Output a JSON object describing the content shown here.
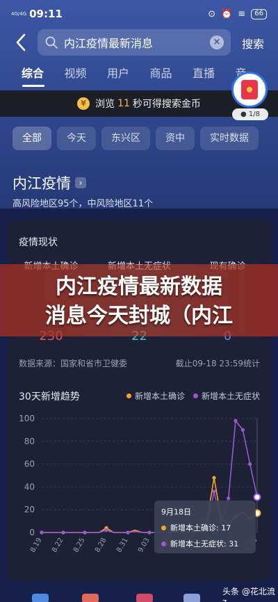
{
  "status": {
    "network": "4G/4G",
    "time": "09:11",
    "battery": "66"
  },
  "search": {
    "query": "内江疫情最新消息",
    "button": "搜索"
  },
  "tabs": [
    "综合",
    "视频",
    "用户",
    "商品",
    "直播",
    "音"
  ],
  "coin_bar": {
    "prefix": "浏览",
    "seconds": "11",
    "suffix": "秒可得搜索金币"
  },
  "reward": {
    "progress": "1/8"
  },
  "chips": [
    "全部",
    "今天",
    "东兴区",
    "资中",
    "实时数据"
  ],
  "section": {
    "title": "内江疫情",
    "summary": "高风险地区95个，中风险地区11个"
  },
  "card": {
    "title": "疫情现状",
    "stats": [
      {
        "label": "新增本土确诊",
        "value": "230",
        "color": "#e5535d"
      },
      {
        "label": "新增本土无症状",
        "value": "22",
        "color": "#3ac6cf"
      },
      {
        "label": "现有确诊",
        "value": "0",
        "color": "#5f84d6"
      }
    ],
    "source": "数据来源：国家和省市卫健委",
    "updated": "截止09-18 23:59统计",
    "trend_title": "30天新增趋势"
  },
  "tooltip": {
    "date": "9月18日",
    "row1": "新增本土确诊: 17",
    "row2": "新增本土无症状: 31"
  },
  "banner": "内江疫情最新数据\n消息今天封城（内江",
  "watermark": "头条 @花北流z",
  "chart_data": {
    "type": "line",
    "x": [
      "8.19",
      "8.20",
      "8.21",
      "8.22",
      "8.23",
      "8.24",
      "8.25",
      "8.26",
      "8.27",
      "8.28",
      "8.29",
      "8.30",
      "8.31",
      "9.01",
      "9.02",
      "9.03",
      "9.04",
      "9.05",
      "9.06",
      "9.07",
      "9.08",
      "9.09",
      "9.10",
      "9.11",
      "9.12",
      "9.13",
      "9.14",
      "9.15",
      "9.16",
      "9.17",
      "9.18"
    ],
    "x_ticks": [
      "8.19",
      "8.22",
      "8.25",
      "8.28",
      "8.31",
      "9.03",
      "9.06",
      "9.09",
      "9.12",
      "9.15",
      "9.18"
    ],
    "ylim": [
      0,
      100
    ],
    "y_ticks": [
      0,
      20,
      40,
      60,
      80,
      100
    ],
    "grid": true,
    "legend": "top-right",
    "series": [
      {
        "name": "新增本土确诊",
        "color": "#f4a62a",
        "values": [
          0,
          0,
          0,
          0,
          0,
          0,
          0,
          0,
          0,
          4,
          0,
          0,
          0,
          2,
          0,
          0,
          0,
          0,
          0,
          0,
          0,
          3,
          4,
          10,
          48,
          12,
          8,
          14,
          18,
          12,
          17
        ]
      },
      {
        "name": "新增本土无症状",
        "color": "#9b57d3",
        "values": [
          0,
          0,
          0,
          0,
          0,
          0,
          0,
          0,
          0,
          2,
          0,
          0,
          0,
          1,
          0,
          0,
          0,
          0,
          0,
          0,
          0,
          1,
          2,
          4,
          36,
          8,
          30,
          98,
          90,
          60,
          31
        ]
      }
    ]
  }
}
